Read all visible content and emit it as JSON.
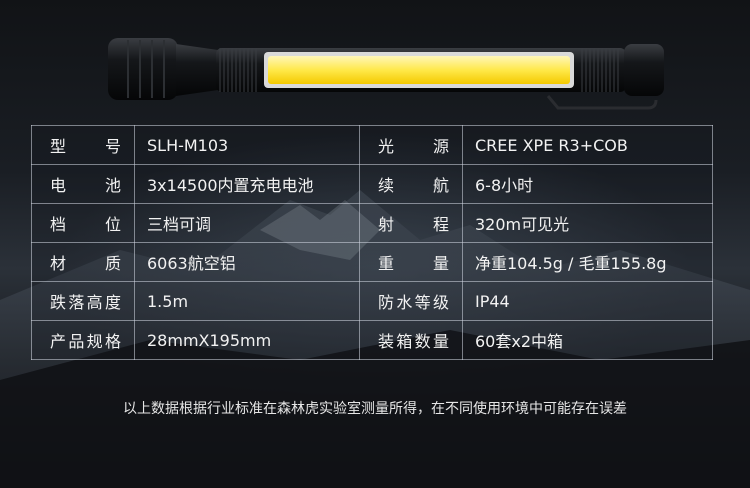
{
  "specs": [
    {
      "label_left": "型号",
      "value_left": "SLH-M103",
      "label_right": "光源",
      "value_right": "CREE XPE R3+COB"
    },
    {
      "label_left": "电池",
      "value_left": "3x14500内置充电电池",
      "label_right": "续航",
      "value_right": "6-8小时"
    },
    {
      "label_left": "档位",
      "value_left": "三档可调",
      "label_right": "射程",
      "value_right": "320m可见光"
    },
    {
      "label_left": "材质",
      "value_left": "6063航空铝",
      "label_right": "重量",
      "value_right": "净重104.5g / 毛重155.8g"
    },
    {
      "label_left": "跌落高度",
      "value_left": "1.5m",
      "label_right": "防水等级",
      "value_right": "IP44"
    },
    {
      "label_left": "产品规格",
      "value_left": "28mmX195mm",
      "label_right": "装箱数量",
      "value_right": "60套x2中箱"
    }
  ],
  "footnote": "以上数据根据行业标准在森林虎实验室测量所得，在不同使用环境中可能存在误差"
}
